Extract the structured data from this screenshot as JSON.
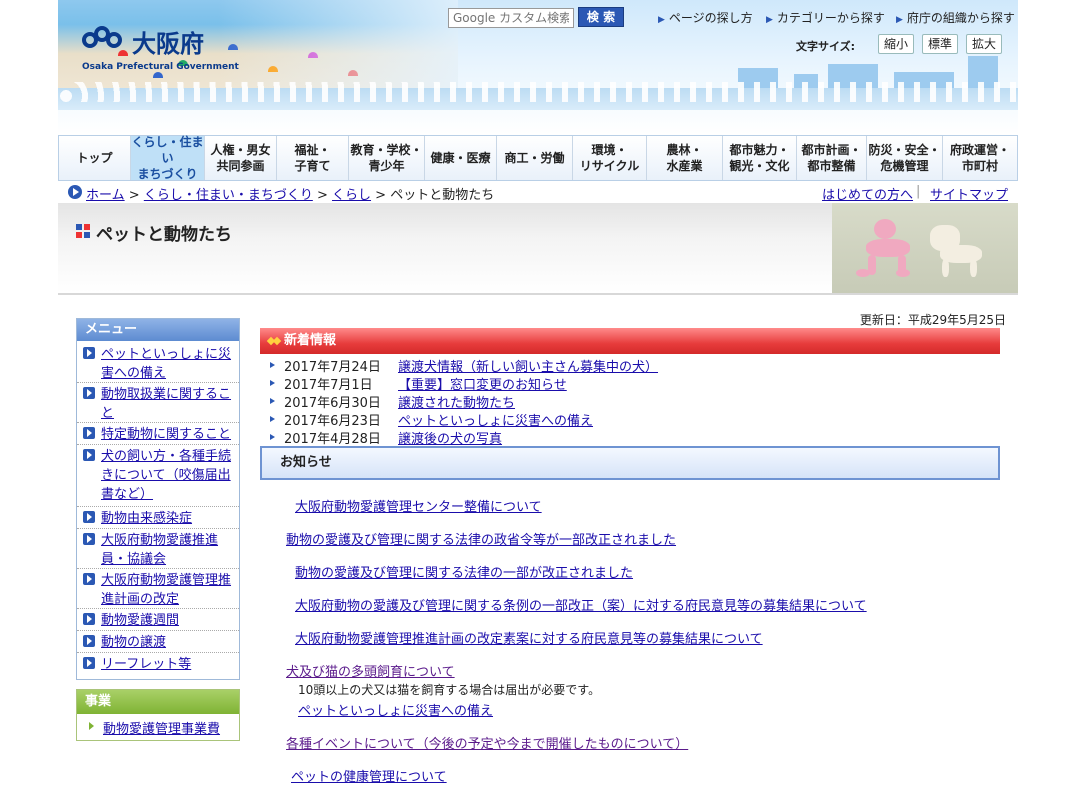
{
  "header": {
    "logo_jp": "大阪府",
    "logo_en": "Osaka Prefectural Government",
    "search_placeholder": "Google カスタム検索",
    "search_button": "検 索",
    "top_links": [
      "ページの探し方",
      "カテゴリーから探す",
      "府庁の組織から探す"
    ],
    "font_size_label": "文字サイズ:",
    "font_size_buttons": [
      "縮小",
      "標準",
      "拡大"
    ]
  },
  "global_nav": [
    {
      "l1": "トップ",
      "l2": ""
    },
    {
      "l1": "くらし・住まい",
      "l2": "まちづくり"
    },
    {
      "l1": "人権・男女",
      "l2": "共同参画"
    },
    {
      "l1": "福祉・",
      "l2": "子育て"
    },
    {
      "l1": "教育・学校・",
      "l2": "青少年"
    },
    {
      "l1": "健康・医療",
      "l2": ""
    },
    {
      "l1": "商工・労働",
      "l2": ""
    },
    {
      "l1": "環境・",
      "l2": "リサイクル"
    },
    {
      "l1": "農林・",
      "l2": "水産業"
    },
    {
      "l1": "都市魅力・",
      "l2": "観光・文化"
    },
    {
      "l1": "都市計画・",
      "l2": "都市整備"
    },
    {
      "l1": "防災・安全・",
      "l2": "危機管理"
    },
    {
      "l1": "府政運営・",
      "l2": "市町村"
    }
  ],
  "breadcrumb": {
    "home": "ホーム",
    "sep": ">",
    "level1": "くらし・住まい・まちづくり",
    "level2": "くらし",
    "current": "ペットと動物たち"
  },
  "help_links": [
    "はじめての方へ",
    "サイトマップ"
  ],
  "page_title": "ペットと動物たち",
  "updated": "更新日：平成29年5月25日",
  "menu": {
    "title": "メニュー",
    "items": [
      "ペットといっしょに災害への備え",
      "動物取扱業に関すること",
      "特定動物に関すること",
      "犬の飼い方・各種手続きについて（咬傷届出書など）",
      "動物由来感染症",
      "大阪府動物愛護推進員・協議会",
      "大阪府動物愛護管理推進計画の改定",
      "動物愛護週間",
      "動物の譲渡",
      "リーフレット等"
    ]
  },
  "business": {
    "title": "事業",
    "item": "動物愛護管理事業費"
  },
  "news": {
    "title": "新着情報",
    "items": [
      {
        "date": "2017年7月24日",
        "title": "譲渡犬情報（新しい飼い主さん募集中の犬）"
      },
      {
        "date": "2017年7月1日",
        "title": "【重要】窓口変更のお知らせ"
      },
      {
        "date": "2017年6月30日",
        "title": "譲渡された動物たち"
      },
      {
        "date": "2017年6月23日",
        "title": "ペットといっしょに災害への備え"
      },
      {
        "date": "2017年4月28日",
        "title": "譲渡後の犬の写真"
      }
    ]
  },
  "notices": {
    "title": "お知らせ",
    "links": [
      "大阪府動物愛護管理センター整備について",
      "動物の愛護及び管理に関する法律の政省令等が一部改正されました",
      "動物の愛護及び管理に関する法律の一部が改正されました",
      "大阪府動物の愛護及び管理に関する条例の一部改正（案）に対する府民意見等の募集結果について",
      "大阪府動物愛護管理推進計画の改定素案に対する府民意見等の募集結果について",
      "犬及び猫の多頭飼育について"
    ],
    "note": "10頭以上の犬又は猫を飼育する場合は届出が必要です。",
    "link_disaster": "ペットといっしょに災害への備え",
    "link_events": "各種イベントについて（今後の予定や今まで開催したものについて）",
    "link_health": "ペットの健康管理について"
  },
  "colors": {
    "brand": "#0a3a8c",
    "news_header": "#e73c3c",
    "notice_border": "#6e93d2",
    "menu_header": "#5d8bd1",
    "biz_header": "#7fb334"
  }
}
